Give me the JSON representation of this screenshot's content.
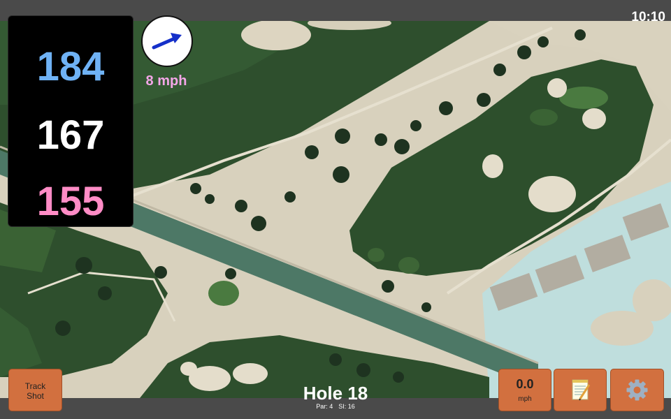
{
  "status_bar": {
    "time": "10:10"
  },
  "distances": {
    "back": "184",
    "middle": "167",
    "front": "155"
  },
  "wind": {
    "speed": "8 mph",
    "direction_icon": "wind-arrow-icon"
  },
  "hole": {
    "title": "Hole 18",
    "par": "Par: 4",
    "stroke_index": "SI: 16"
  },
  "buttons": {
    "track_shot": "Track\nShot",
    "speed_value": "0.0",
    "speed_unit": "mph",
    "notes_icon": "notepad-icon",
    "settings_icon": "gear-icon"
  },
  "colors": {
    "back_distance": "#6fb2f5",
    "middle_distance": "#ffffff",
    "front_distance": "#ff8cc6",
    "button_fill": "#d2703f",
    "wind_text": "#f4a6e8"
  }
}
